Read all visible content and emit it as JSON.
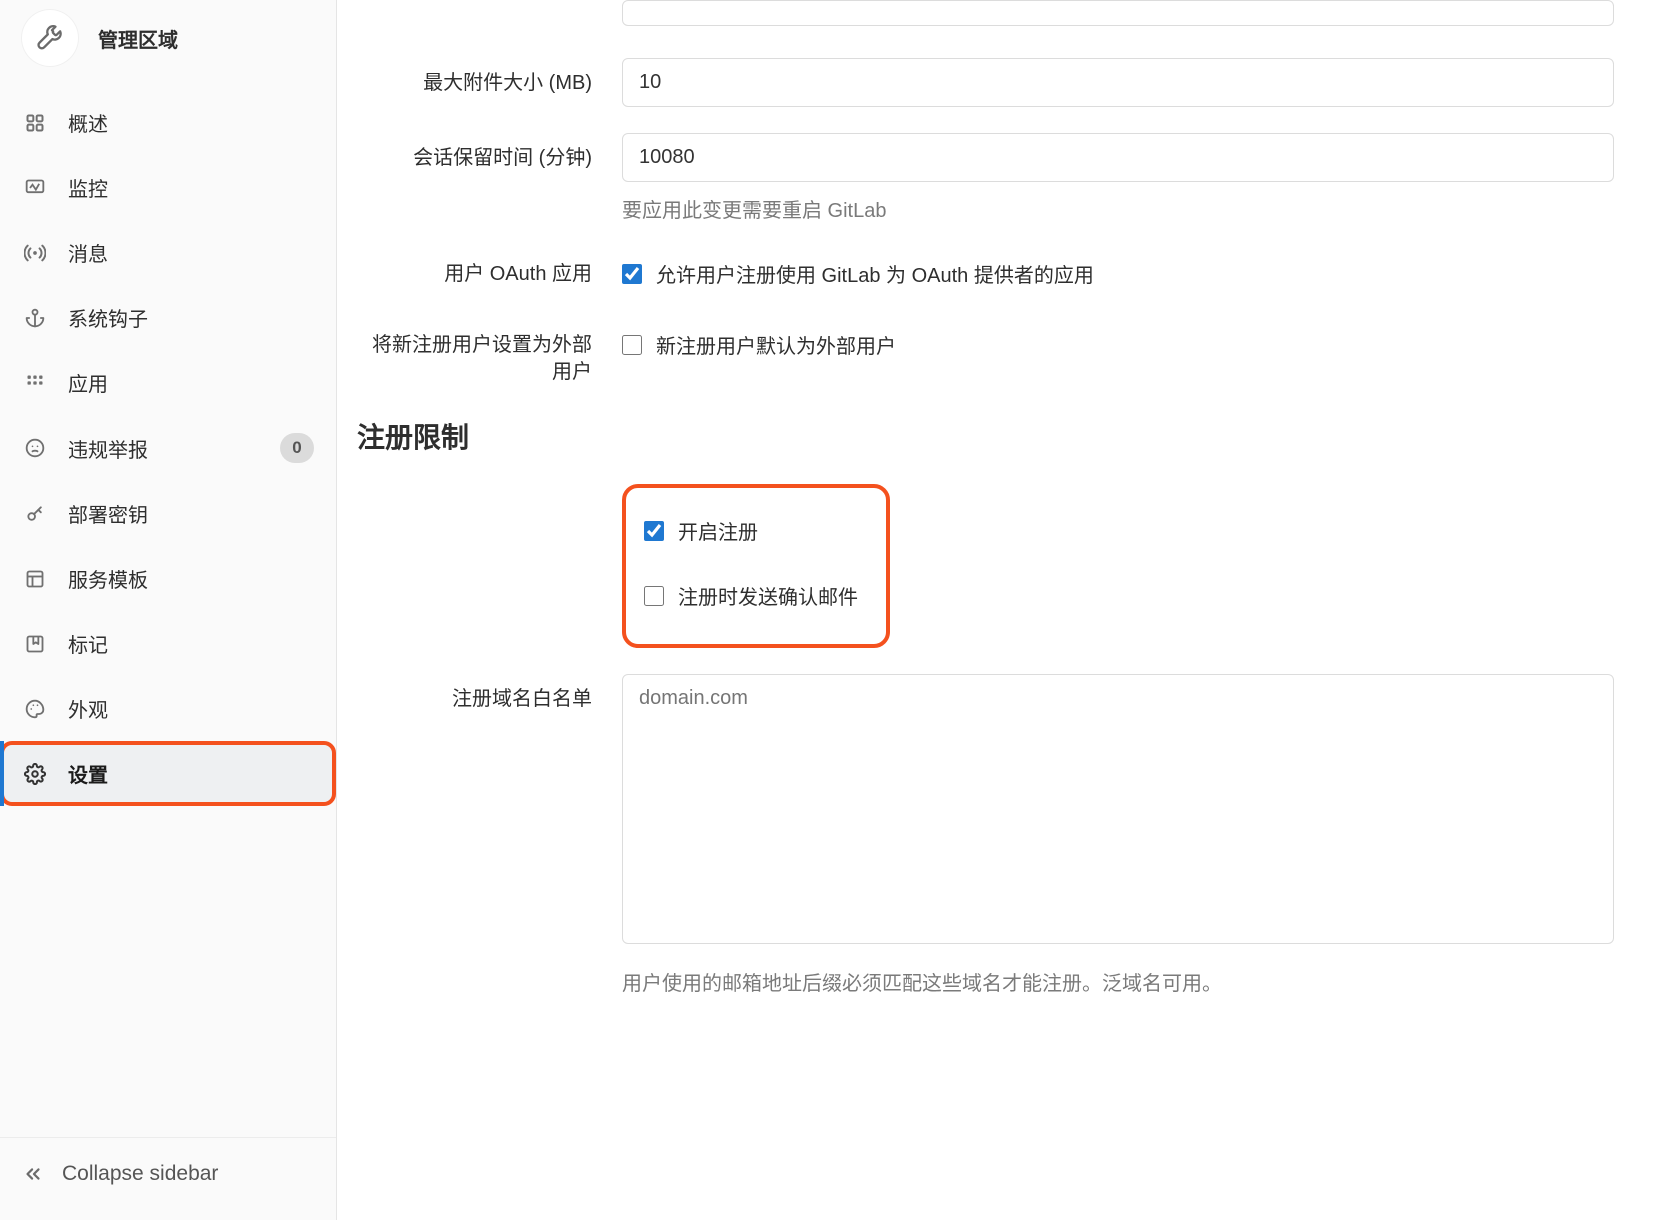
{
  "sidebar": {
    "title": "管理区域",
    "items": [
      {
        "key": "overview",
        "label": "概述",
        "icon": "grid-icon",
        "badge": null,
        "active": false
      },
      {
        "key": "monitor",
        "label": "监控",
        "icon": "monitor-icon",
        "badge": null,
        "active": false
      },
      {
        "key": "messages",
        "label": "消息",
        "icon": "broadcast-icon",
        "badge": null,
        "active": false
      },
      {
        "key": "hooks",
        "label": "系统钩子",
        "icon": "anchor-icon",
        "badge": null,
        "active": false
      },
      {
        "key": "apps",
        "label": "应用",
        "icon": "apps-icon",
        "badge": null,
        "active": false
      },
      {
        "key": "abuse",
        "label": "违规举报",
        "icon": "face-icon",
        "badge": "0",
        "active": false
      },
      {
        "key": "deploy",
        "label": "部署密钥",
        "icon": "key-icon",
        "badge": null,
        "active": false
      },
      {
        "key": "templates",
        "label": "服务模板",
        "icon": "template-icon",
        "badge": null,
        "active": false
      },
      {
        "key": "labels",
        "label": "标记",
        "icon": "bookmark-icon",
        "badge": null,
        "active": false
      },
      {
        "key": "appearance",
        "label": "外观",
        "icon": "palette-icon",
        "badge": null,
        "active": false
      },
      {
        "key": "settings",
        "label": "设置",
        "icon": "gear-icon",
        "badge": null,
        "active": true
      }
    ],
    "collapse_label": "Collapse sidebar"
  },
  "form": {
    "max_attachment": {
      "label": "最大附件大小 (MB)",
      "value": "10"
    },
    "session_keep": {
      "label": "会话保留时间 (分钟)",
      "value": "10080",
      "help": "要应用此变更需要重启 GitLab"
    },
    "oauth": {
      "label": "用户 OAuth 应用",
      "checkbox_label": "允许用户注册使用 GitLab 为 OAuth 提供者的应用",
      "checked": true
    },
    "external_user": {
      "label": "将新注册用户设置为外部用户",
      "checkbox_label": "新注册用户默认为外部用户",
      "checked": false
    },
    "signup": {
      "section_title": "注册限制",
      "enable": {
        "label": "开启注册",
        "checked": true
      },
      "confirm": {
        "label": "注册时发送确认邮件",
        "checked": false
      },
      "whitelist": {
        "label": "注册域名白名单",
        "placeholder": "domain.com",
        "value": "",
        "help": "用户使用的邮箱地址后缀必须匹配这些域名才能注册。泛域名可用。"
      }
    }
  }
}
